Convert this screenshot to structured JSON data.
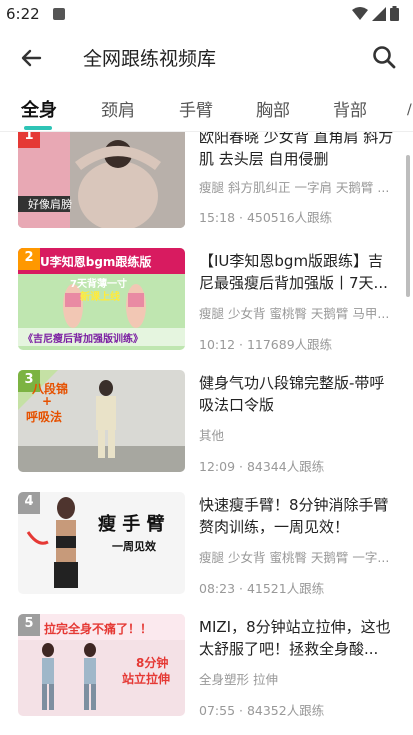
{
  "status": {
    "time": "6:22"
  },
  "header": {
    "title": "全网跟练视频库"
  },
  "tabs": [
    "全身",
    "颈肩",
    "手臂",
    "胸部",
    "背部"
  ],
  "videos": [
    {
      "num": "1",
      "title": "欧阳春晓 少女背 直角肩 斜方肌 去头层 自用侵删",
      "tags": "瘦腿 斜方肌纠正 一字肩 天鹅臂 ...",
      "meta": "15:18 · 450516人跟练",
      "badge_color": "#e53935",
      "thumb_text": "好像肩膀"
    },
    {
      "num": "2",
      "title": "【IU李知恩bgm版跟练】吉尼最强瘦后背加强版丨7天...",
      "tags": "瘦腿 少女背 蜜桃臀 天鹅臂 马甲...",
      "meta": "10:12 · 117689人跟练",
      "badge_color": "#ff9800",
      "thumb_text": "U李知恩bgm跟练版",
      "thumb_sub": "7天背薄一寸",
      "thumb_sub2": "新课上线",
      "thumb_bottom": "《吉尼瘦后背加强版训练》"
    },
    {
      "num": "3",
      "title": "健身气功八段锦完整版-带呼吸法口令版",
      "tags": "其他",
      "meta": "12:09 · 84344人跟练",
      "badge_color": "#7cb342",
      "thumb_text": "八段锦",
      "thumb_sub": "+",
      "thumb_sub2": "呼吸法"
    },
    {
      "num": "4",
      "title": "快速瘦手臂！8分钟消除手臂赘肉训练，一周见效！（MI...",
      "tags": "瘦腿 少女背 蜜桃臀 天鹅臂 一字...",
      "meta": "08:23 · 41521人跟练",
      "badge_color": "#9e9e9e",
      "thumb_text": "瘦 手 臂",
      "thumb_sub": "一周见效"
    },
    {
      "num": "5",
      "title": "MIZI，8分钟站立拉伸，这也太舒服了吧！拯救全身酸...",
      "tags": "全身塑形 拉伸",
      "meta": "07:55 · 84352人跟练",
      "badge_color": "#9e9e9e",
      "thumb_text": "拉完全身不痛了！！",
      "thumb_sub": "8分钟",
      "thumb_sub2": "站立拉伸"
    }
  ]
}
